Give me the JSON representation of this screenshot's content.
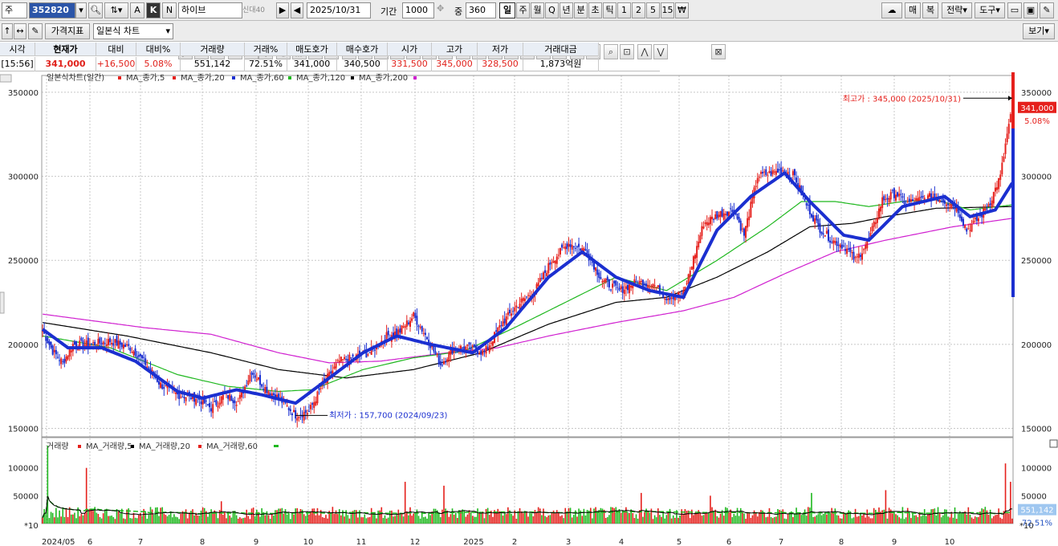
{
  "toolbar": {
    "market_label": "주",
    "code": "352820",
    "btn_a": "A",
    "btn_k": "K",
    "btn_n": "N",
    "name": "하이브",
    "badge_1": "신",
    "badge_2": "대",
    "badge_3": "40",
    "date": "2025/10/31",
    "period_label": "기간",
    "period_value": "1000",
    "count_label": "중",
    "count_value": "360",
    "periods": [
      "일",
      "주",
      "월",
      "Q",
      "년",
      "분",
      "초",
      "틱",
      "1",
      "2",
      "5",
      "15",
      "₩"
    ],
    "right_buttons": [
      "매",
      "복",
      "전략",
      "도구"
    ]
  },
  "toolbar2": {
    "price_indicator": "가격지표",
    "chart_type": "일본식 차트",
    "view_button": "보기"
  },
  "quote": {
    "headers": [
      "시각",
      "현재가",
      "대비",
      "대비%",
      "거래량",
      "거래%",
      "매도호가",
      "매수호가",
      "시가",
      "고가",
      "저가",
      "거래대금"
    ],
    "values": [
      "[15:56]",
      "341,000",
      "+16,500",
      "5.08%",
      "551,142",
      "72.51%",
      "341,000",
      "340,500",
      "331,500",
      "345,000",
      "328,500",
      "1,873억원"
    ]
  },
  "colors": {
    "candle_up": "#e5201c",
    "candle_down": "#1b2fd0",
    "ma5": "#e5201c",
    "ma20": "#1b2fd0",
    "ma60": "#1fb81f",
    "ma120": "#000000",
    "ma200": "#d020d0",
    "vol_up": "#e5201c",
    "vol_ma5": "#e5201c",
    "vol_ma20": "#000000",
    "vol_ma60": "#1fb81f",
    "vol_bar_up": "#e5201c",
    "vol_bar_down": "#1fb81f"
  },
  "chart_data": [
    {
      "type": "line",
      "title": "",
      "legend": [
        "일본식차트(일간)",
        "MA_종가,5",
        "MA_종가,20",
        "MA_종가,60",
        "MA_종가,120",
        "MA_종가,200"
      ],
      "x_labels": [
        "2024/05",
        "6",
        "7",
        "8",
        "9",
        "10",
        "11",
        "12",
        "2025",
        "2",
        "3",
        "4",
        "5",
        "6",
        "7",
        "8",
        "9",
        "10"
      ],
      "ylim": [
        145000,
        360000
      ],
      "yticks": [
        "350000",
        "300000",
        "250000",
        "200000",
        "150000"
      ],
      "ytick_values": [
        350000,
        300000,
        250000,
        200000,
        150000
      ],
      "high_annotation": "최고가 : 345,000 (2025/10/31)",
      "low_annotation": "최저가 : 157,700 (2024/09/23)",
      "last_price": "341,000",
      "last_change": "5.08%",
      "series": [
        {
          "name": "MA_종가,5",
          "key": "ma5"
        },
        {
          "name": "MA_종가,20",
          "key": "ma20"
        },
        {
          "name": "MA_종가,60",
          "key": "ma60"
        },
        {
          "name": "MA_종가,120",
          "key": "ma120"
        },
        {
          "name": "MA_종가,200",
          "key": "ma200"
        }
      ],
      "close_anchors": [
        [
          0,
          208000
        ],
        [
          6,
          196000
        ],
        [
          12,
          189000
        ],
        [
          18,
          200000
        ],
        [
          28,
          200000
        ],
        [
          40,
          202000
        ],
        [
          52,
          198000
        ],
        [
          60,
          190000
        ],
        [
          70,
          176000
        ],
        [
          80,
          170000
        ],
        [
          92,
          168000
        ],
        [
          100,
          162000
        ],
        [
          108,
          170000
        ],
        [
          116,
          166000
        ],
        [
          124,
          184000
        ],
        [
          132,
          174000
        ],
        [
          140,
          168000
        ],
        [
          150,
          158000
        ],
        [
          158,
          160000
        ],
        [
          166,
          176000
        ],
        [
          176,
          190000
        ],
        [
          184,
          192000
        ],
        [
          194,
          195000
        ],
        [
          204,
          205000
        ],
        [
          212,
          208000
        ],
        [
          220,
          217000
        ],
        [
          228,
          204000
        ],
        [
          236,
          188000
        ],
        [
          244,
          198000
        ],
        [
          252,
          198000
        ],
        [
          262,
          195000
        ],
        [
          272,
          212000
        ],
        [
          282,
          224000
        ],
        [
          292,
          232000
        ],
        [
          302,
          250000
        ],
        [
          312,
          260000
        ],
        [
          322,
          256000
        ],
        [
          332,
          238000
        ],
        [
          342,
          232000
        ],
        [
          352,
          237000
        ],
        [
          362,
          236000
        ],
        [
          370,
          228000
        ],
        [
          380,
          230000
        ],
        [
          392,
          272000
        ],
        [
          402,
          278000
        ],
        [
          410,
          280000
        ],
        [
          416,
          265000
        ],
        [
          424,
          300000
        ],
        [
          432,
          302000
        ],
        [
          440,
          304000
        ],
        [
          446,
          300000
        ],
        [
          452,
          285000
        ],
        [
          460,
          270000
        ],
        [
          468,
          262000
        ],
        [
          476,
          258000
        ],
        [
          482,
          250000
        ],
        [
          490,
          262000
        ],
        [
          498,
          286000
        ],
        [
          506,
          290000
        ],
        [
          512,
          284000
        ],
        [
          520,
          286000
        ],
        [
          528,
          288000
        ],
        [
          536,
          285000
        ],
        [
          542,
          282000
        ],
        [
          548,
          268000
        ],
        [
          556,
          276000
        ],
        [
          562,
          285000
        ],
        [
          568,
          300000
        ],
        [
          572,
          325000
        ],
        [
          575,
          340000
        ]
      ],
      "ma_anchors": {
        "ma20": [
          [
            0,
            209000
          ],
          [
            15,
            198000
          ],
          [
            35,
            198000
          ],
          [
            55,
            190000
          ],
          [
            80,
            172000
          ],
          [
            95,
            168000
          ],
          [
            115,
            173000
          ],
          [
            130,
            170000
          ],
          [
            150,
            165000
          ],
          [
            170,
            180000
          ],
          [
            190,
            195000
          ],
          [
            210,
            205000
          ],
          [
            230,
            200000
          ],
          [
            255,
            195000
          ],
          [
            275,
            210000
          ],
          [
            300,
            240000
          ],
          [
            320,
            255000
          ],
          [
            340,
            240000
          ],
          [
            360,
            232000
          ],
          [
            380,
            228000
          ],
          [
            400,
            268000
          ],
          [
            420,
            288000
          ],
          [
            440,
            302000
          ],
          [
            455,
            285000
          ],
          [
            475,
            265000
          ],
          [
            490,
            262000
          ],
          [
            510,
            282000
          ],
          [
            535,
            288000
          ],
          [
            550,
            276000
          ],
          [
            565,
            280000
          ],
          [
            575,
            296000
          ]
        ],
        "ma60": [
          [
            0,
            205000
          ],
          [
            40,
            198000
          ],
          [
            80,
            182000
          ],
          [
            110,
            175000
          ],
          [
            140,
            172000
          ],
          [
            160,
            173000
          ],
          [
            190,
            185000
          ],
          [
            220,
            192000
          ],
          [
            250,
            196000
          ],
          [
            280,
            210000
          ],
          [
            310,
            225000
          ],
          [
            340,
            240000
          ],
          [
            370,
            232000
          ],
          [
            400,
            250000
          ],
          [
            430,
            270000
          ],
          [
            450,
            285000
          ],
          [
            470,
            285000
          ],
          [
            490,
            282000
          ],
          [
            510,
            285000
          ],
          [
            530,
            286000
          ],
          [
            550,
            280000
          ],
          [
            575,
            283000
          ]
        ],
        "ma120": [
          [
            0,
            213000
          ],
          [
            50,
            205000
          ],
          [
            100,
            195000
          ],
          [
            140,
            185000
          ],
          [
            180,
            180000
          ],
          [
            220,
            185000
          ],
          [
            260,
            195000
          ],
          [
            300,
            212000
          ],
          [
            340,
            225000
          ],
          [
            370,
            228000
          ],
          [
            400,
            240000
          ],
          [
            430,
            255000
          ],
          [
            455,
            270000
          ],
          [
            480,
            272000
          ],
          [
            500,
            276000
          ],
          [
            530,
            281000
          ],
          [
            575,
            282000
          ]
        ],
        "ma200": [
          [
            0,
            218000
          ],
          [
            60,
            210000
          ],
          [
            100,
            206000
          ],
          [
            140,
            195000
          ],
          [
            170,
            189000
          ],
          [
            200,
            190000
          ],
          [
            240,
            195000
          ],
          [
            270,
            198000
          ],
          [
            300,
            205000
          ],
          [
            340,
            213000
          ],
          [
            380,
            220000
          ],
          [
            410,
            228000
          ],
          [
            440,
            242000
          ],
          [
            470,
            255000
          ],
          [
            500,
            262000
          ],
          [
            540,
            270000
          ],
          [
            575,
            275000
          ]
        ]
      }
    },
    {
      "type": "bar",
      "title": "",
      "legend": [
        "거래량",
        "MA_거래량,5",
        "MA_거래량,20",
        "MA_거래량,60"
      ],
      "ylim": [
        0,
        140000
      ],
      "yticks": [
        "100000",
        "50000"
      ],
      "ytick_values": [
        100000,
        50000
      ],
      "unit_label": "*10",
      "last_volume": "551,142",
      "last_volume_pct": "72.51%",
      "spikes": [
        [
          3,
          140000
        ],
        [
          26,
          100000
        ],
        [
          106,
          40000
        ],
        [
          215,
          75000
        ],
        [
          238,
          68000
        ],
        [
          355,
          55000
        ],
        [
          396,
          50000
        ],
        [
          456,
          55000
        ],
        [
          500,
          60000
        ],
        [
          571,
          108000
        ],
        [
          574,
          75000
        ]
      ]
    }
  ]
}
